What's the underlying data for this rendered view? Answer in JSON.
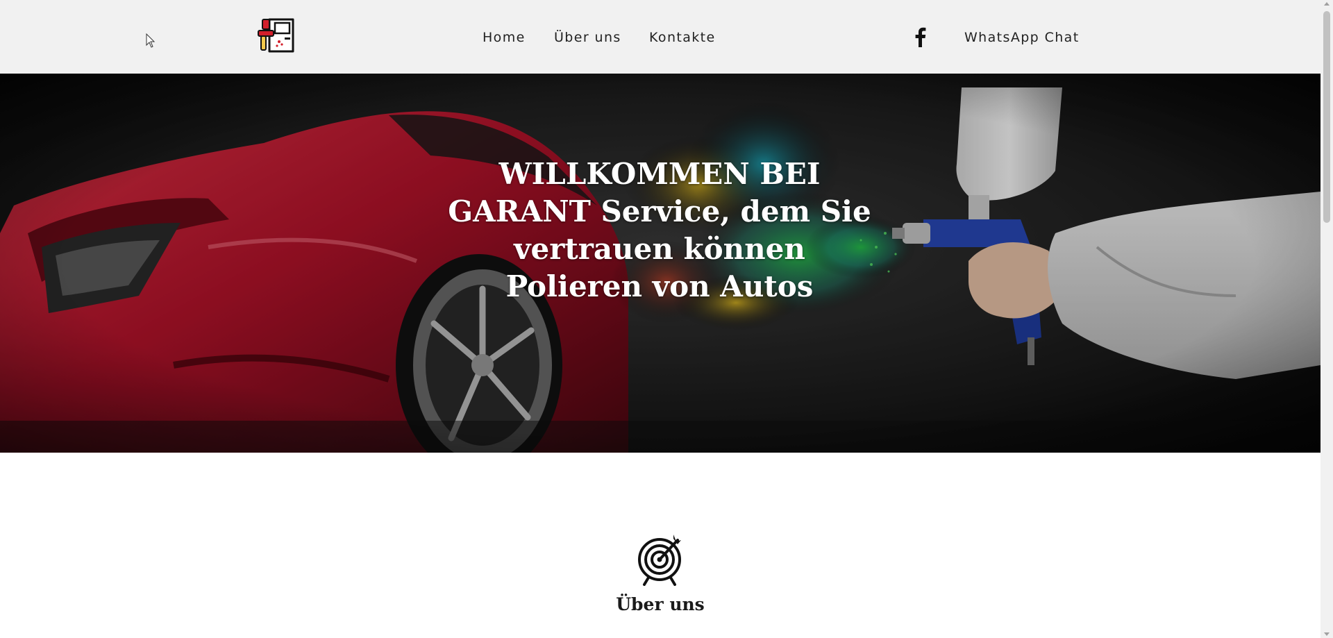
{
  "nav": {
    "home": "Home",
    "about": "Über uns",
    "contacts": "Kontakte",
    "whatsapp": "WhatsApp Chat"
  },
  "icons": {
    "logo": "spray-gun-car-door-logo-icon",
    "facebook": "facebook-icon",
    "section": "target-dart-icon",
    "cursor": "mouse-cursor-icon"
  },
  "hero": {
    "title": "WILLKOMMEN BEI GARANT Service, dem Sie vertrauen können Polieren von Autos"
  },
  "section": {
    "title": "Über uns"
  },
  "colors": {
    "header_bg": "#f1f1f1",
    "nav_text": "#222222",
    "hero_text": "#ffffff",
    "car_red": "#b3122a"
  }
}
